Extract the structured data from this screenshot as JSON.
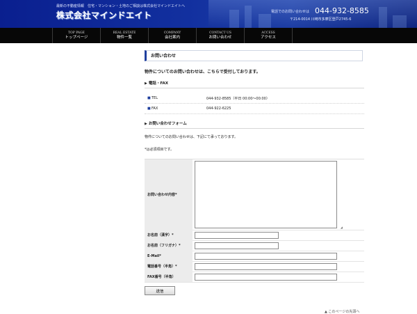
{
  "header": {
    "tagline": "最新の不動産情報　住宅・マンション・土地のご相談は株式会社マインドエイトへ",
    "logo": "株式会社マインドエイト",
    "tel_label": "電話でのお問い合わせは",
    "tel_number": "044-932-8585",
    "address": "〒214-0014 川崎市多摩区登戸2745-6"
  },
  "nav": [
    {
      "en": "TOP PAGE",
      "jp": "トップページ"
    },
    {
      "en": "REAL ESTATE",
      "jp": "物件一覧"
    },
    {
      "en": "COMPANY",
      "jp": "会社案内"
    },
    {
      "en": "CONTACT US",
      "jp": "お問い合わせ"
    },
    {
      "en": "ACCESS",
      "jp": "アクセス"
    }
  ],
  "page": {
    "title": "お問い合わせ",
    "lead": "物件についてのお問い合わせは、こちらで受付しております。"
  },
  "phone_section": {
    "heading": "電話・FAX",
    "rows": [
      {
        "label": "TEL",
        "value": "044-932-8585（平日 00:00～00:00）"
      },
      {
        "label": "FAX",
        "value": "044-922-6225"
      }
    ]
  },
  "form_section": {
    "heading": "お問い合わせフォーム",
    "intro": "物件についてのお問い合わせは、下記にて承っております。",
    "required_note": "*は必須項目です。",
    "fields": {
      "message": "お問い合わせ内容*",
      "name_kanji": "お名前（漢字）*",
      "name_kana": "お名前（フリガナ）*",
      "email": "E-Mail*",
      "phone": "電話番号（半角）*",
      "fax": "FAX番号（半角）"
    },
    "values": {
      "message": "",
      "name_kanji": "",
      "name_kana": "",
      "email": "",
      "phone": "",
      "fax": ""
    },
    "submit_label": "送信"
  },
  "footer": {
    "to_top": "▲ このページの先頭へ"
  },
  "colors": {
    "header_blue": "#12309f",
    "nav_black": "#070707",
    "accent_blue": "#1f3f9e",
    "label_bg": "#ececec"
  },
  "icons": {
    "section_arrow": "triangle-right-icon",
    "bullet": "square-bullet-icon",
    "to_top": "triangle-up-icon"
  }
}
